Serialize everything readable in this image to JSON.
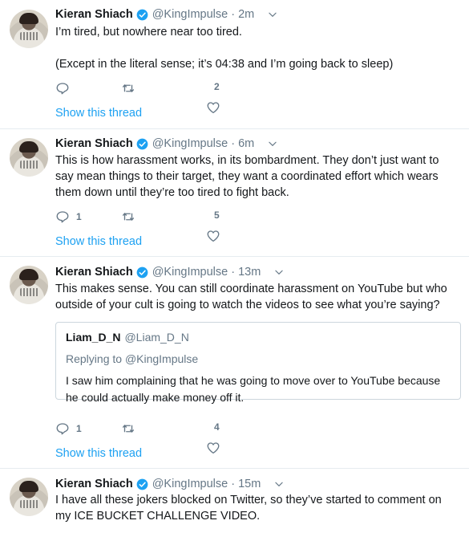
{
  "icons": {
    "verified": "verified-badge-icon",
    "chevron": "chevron-down-icon",
    "reply": "reply-icon",
    "retweet": "retweet-icon",
    "like": "heart-icon"
  },
  "colors": {
    "accent": "#1da1f2",
    "secondary_text": "#657786",
    "divider": "#e6ecf0"
  },
  "show_thread_label": "Show this thread",
  "tweets": [
    {
      "name": "Kieran Shiach",
      "handle": "@KingImpulse",
      "dot": "·",
      "time": "2m",
      "line1": "I’m tired, but nowhere near too tired.",
      "line2": "(Except in the literal sense; it’s 04:38 and I’m going back to sleep)",
      "reply_count": "",
      "like_count": "2"
    },
    {
      "name": "Kieran Shiach",
      "handle": "@KingImpulse",
      "dot": "·",
      "time": "6m",
      "line1": "This is how harassment works, in its bombardment. They don’t just want to say mean things to their target, they want a coordinated effort which wears them down until they’re too tired to fight back.",
      "reply_count": "1",
      "like_count": "5"
    },
    {
      "name": "Kieran Shiach",
      "handle": "@KingImpulse",
      "dot": "·",
      "time": "13m",
      "line1": "This makes sense. You can still coordinate harassment on YouTube but who outside of your cult is going to watch the videos to see what you’re saying?",
      "reply_count": "1",
      "like_count": "4",
      "quote": {
        "name": "Liam_D_N",
        "handle": "@Liam_D_N",
        "replying_prefix": "Replying to",
        "replying_to": "@KingImpulse",
        "text": "I saw him complaining that he was going to move over to YouTube because he could actually make money off it."
      }
    },
    {
      "name": "Kieran Shiach",
      "handle": "@KingImpulse",
      "dot": "·",
      "time": "15m",
      "line1": "I have all these jokers blocked on Twitter, so they’ve started to comment on my ICE BUCKET CHALLENGE VIDEO."
    }
  ]
}
